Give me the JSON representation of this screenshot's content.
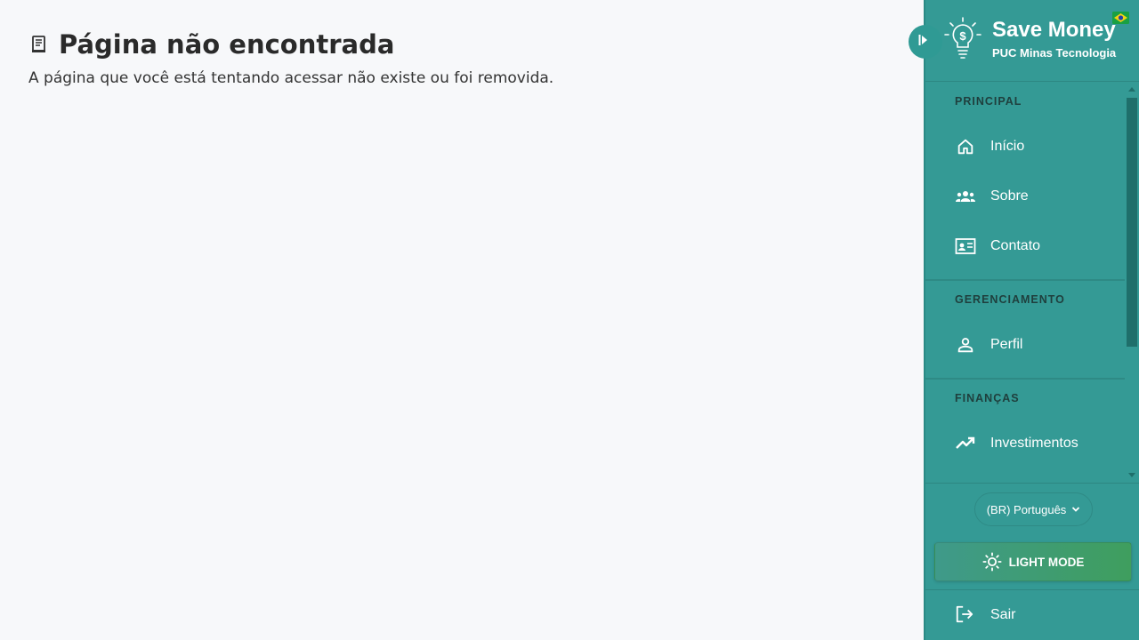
{
  "main": {
    "title_icon": "document-icon",
    "title": "Página não encontrada",
    "subtitle": "A página que você está tentando acessar não existe ou foi removida."
  },
  "brand": {
    "name": "Save Money",
    "subtitle": "PUC Minas Tecnologia",
    "logo_icon": "lightbulb-dollar-icon",
    "flag_icon": "brazil-flag-icon"
  },
  "sidebar": {
    "sections": [
      {
        "label": "PRINCIPAL",
        "items": [
          {
            "label": "Início",
            "icon": "home-icon"
          },
          {
            "label": "Sobre",
            "icon": "group-icon"
          },
          {
            "label": "Contato",
            "icon": "contact-card-icon"
          }
        ]
      },
      {
        "label": "GERENCIAMENTO",
        "items": [
          {
            "label": "Perfil",
            "icon": "person-icon"
          }
        ]
      },
      {
        "label": "FINANÇAS",
        "items": [
          {
            "label": "Investimentos",
            "icon": "trending-up-icon"
          }
        ]
      }
    ]
  },
  "footer": {
    "language": "(BR) Português",
    "mode_button": "LIGHT MODE",
    "logout": "Sair"
  },
  "colors": {
    "sidebar_bg": "#349a95",
    "page_bg": "#f7f8fa",
    "section_label": "#1f3f3d"
  }
}
